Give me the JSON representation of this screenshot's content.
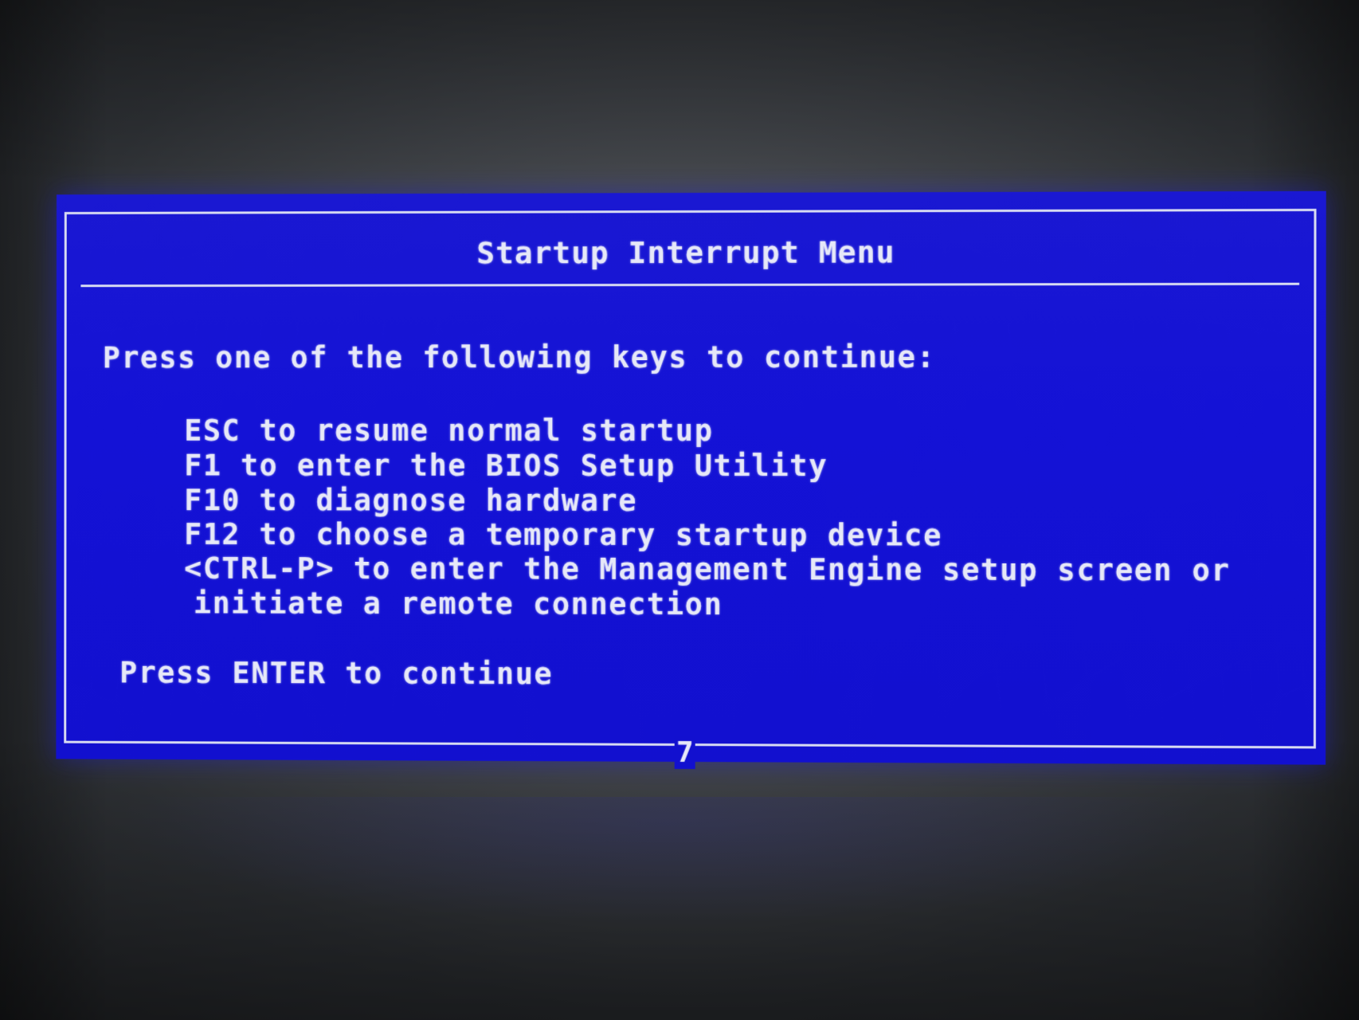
{
  "dialog": {
    "title": "Startup Interrupt Menu",
    "prompt": "Press one of the following keys to continue:",
    "options": [
      {
        "text": "ESC to resume normal startup"
      },
      {
        "text": "F1 to enter the BIOS Setup Utility"
      },
      {
        "text": "F10 to diagnose hardware"
      },
      {
        "text": "F12 to choose a temporary startup device"
      },
      {
        "text": "<CTRL-P> to enter the Management Engine setup screen or"
      },
      {
        "text": "initiate a remote connection"
      }
    ],
    "footer": "Press ENTER to continue",
    "page_marker": "7"
  },
  "colors": {
    "screen_background": "#1412d6",
    "text": "#e6e8f8",
    "surroundings": "#45484d"
  }
}
